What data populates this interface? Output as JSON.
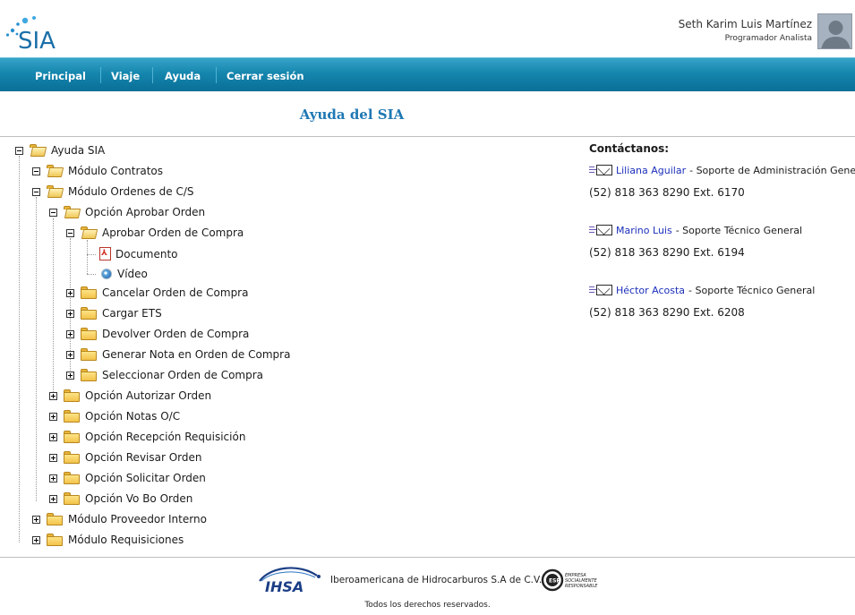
{
  "header": {
    "app_name": "SIA",
    "user_name": "Seth Karim Luis Martínez",
    "user_role": "Programador Analista"
  },
  "nav": {
    "items": [
      "Principal",
      "Viaje",
      "Ayuda",
      "Cerrar sesión"
    ]
  },
  "page": {
    "title": "Ayuda del SIA"
  },
  "tree": {
    "root": "Ayuda SIA",
    "items": [
      "Módulo Contratos",
      "Módulo Ordenes de C/S",
      "Opción Aprobar Orden",
      "Aprobar Orden de Compra",
      "Documento",
      "Vídeo",
      "Cancelar Orden de Compra",
      "Cargar ETS",
      "Devolver Orden de Compra",
      "Generar Nota en Orden de Compra",
      "Seleccionar Orden de Compra",
      "Opción Autorizar Orden",
      "Opción Notas O/C",
      "Opción Recepción Requisición",
      "Opción Revisar Orden",
      "Opción Solicitar Orden",
      "Opción Vo Bo Orden",
      "Módulo Proveedor Interno",
      "Módulo Requisiciones"
    ]
  },
  "contacts": {
    "title": "Contáctanos:",
    "list": [
      {
        "name": "Liliana Aguilar",
        "role": "- Soporte de Administración General",
        "phone": "(52) 818 363 8290 Ext. 6170"
      },
      {
        "name": "Marino Luis",
        "role": "- Soporte Técnico General",
        "phone": "(52) 818 363 8290 Ext. 6194"
      },
      {
        "name": "Héctor Acosta",
        "role": "- Soporte Técnico General",
        "phone": "(52) 818 363 8290 Ext. 6208"
      }
    ]
  },
  "footer": {
    "logo_text": "IHSA",
    "company": "Iberoamericana de Hidrocarburos S.A de C.V.",
    "esr_lines": [
      "EMPRESA",
      "SOCIALMENTE",
      "RESPONSABLE"
    ],
    "rights": "Todos los derechos reservados."
  },
  "colors": {
    "nav_bar": "#1586ae",
    "title": "#1f78b4",
    "link": "#1c2fbb"
  }
}
